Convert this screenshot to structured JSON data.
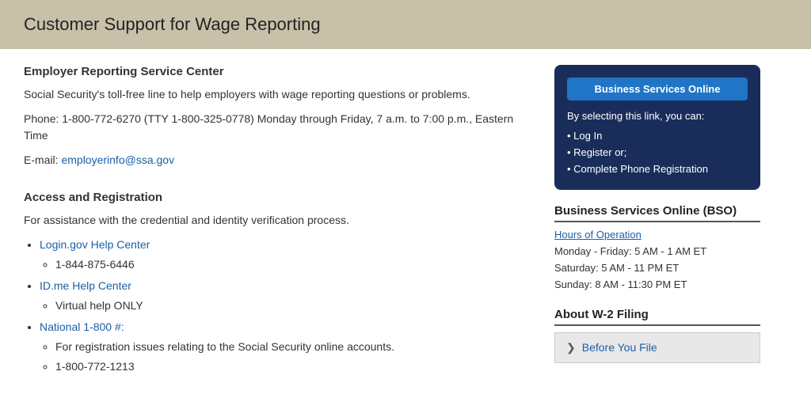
{
  "header": {
    "title": "Customer Support for Wage Reporting"
  },
  "main": {
    "section1": {
      "title": "Employer Reporting Service Center",
      "description": "Social Security's toll-free line to help employers with wage reporting questions or problems.",
      "phone_line": "Phone: 1-800-772-6270 (TTY 1-800-325-0778) Monday through Friday, 7 a.m. to 7:00 p.m., Eastern Time",
      "email_label": "E-mail: ",
      "email_address": "employerinfo@ssa.gov",
      "email_href": "mailto:employerinfo@ssa.gov"
    },
    "section2": {
      "title": "Access and Registration",
      "description": "For assistance with the credential and identity verification process.",
      "list_items": [
        {
          "link_text": "Login.gov Help Center",
          "href": "#",
          "sub_items": [
            "1-844-875-6446"
          ]
        },
        {
          "link_text": "ID.me Help Center",
          "href": "#",
          "sub_items": [
            "Virtual help ONLY"
          ]
        },
        {
          "link_text": "National 1-800 #:",
          "href": "#",
          "sub_items": [
            "For registration issues relating to the Social Security online accounts.",
            "1-800-772-1213"
          ]
        }
      ]
    }
  },
  "sidebar": {
    "bso_card": {
      "button_label": "Business Services Online",
      "description": "By selecting this link, you can:",
      "options": [
        "Log In",
        "Register or;",
        "Complete Phone Registration"
      ]
    },
    "bso_section": {
      "title": "Business Services Online (BSO)",
      "hours_link": "Hours of Operation",
      "hours": [
        "Monday - Friday: 5 AM - 1 AM ET",
        "Saturday: 5 AM - 11 PM ET",
        "Sunday: 8 AM - 11:30 PM ET"
      ]
    },
    "w2_section": {
      "title": "About W-2 Filing",
      "accordion_label": "Before You File"
    }
  }
}
